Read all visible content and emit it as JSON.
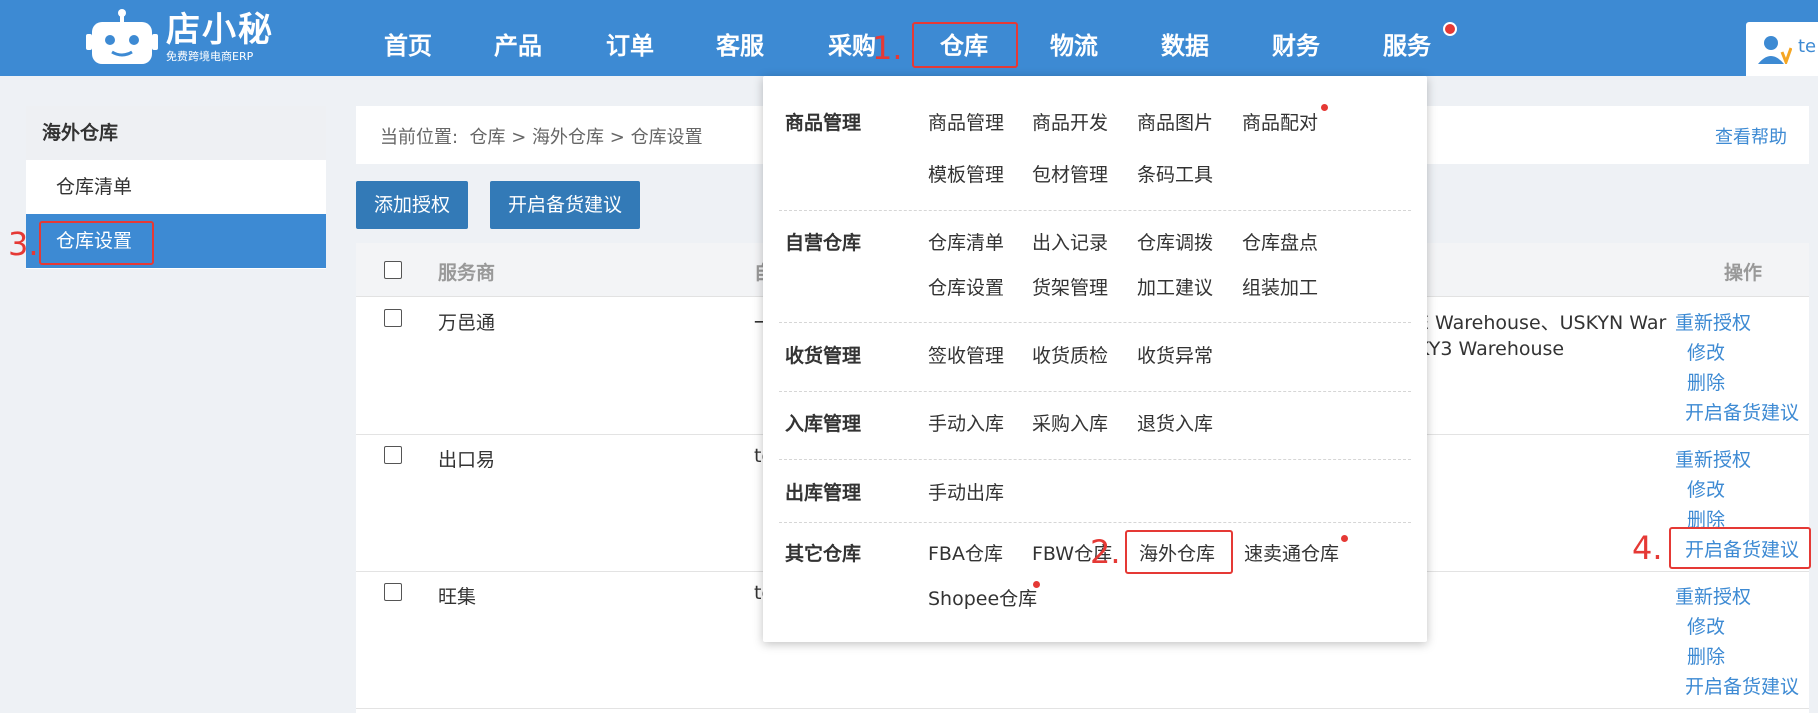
{
  "logo": {
    "title": "店小秘",
    "subtitle": "免费跨境电商ERP"
  },
  "nav": [
    {
      "label": "首页"
    },
    {
      "label": "产品"
    },
    {
      "label": "订单"
    },
    {
      "label": "客服"
    },
    {
      "label": "采购"
    },
    {
      "label": "仓库"
    },
    {
      "label": "物流"
    },
    {
      "label": "数据"
    },
    {
      "label": "财务"
    },
    {
      "label": "服务"
    }
  ],
  "user": {
    "label": "te"
  },
  "steps": {
    "s1": "1.",
    "s2": "2.",
    "s3": "3.",
    "s4": "4."
  },
  "sidebar": {
    "title": "海外仓库",
    "items": [
      {
        "label": "仓库清单"
      },
      {
        "label": "仓库设置"
      }
    ]
  },
  "breadcrumb": {
    "prefix": "当前位置:",
    "path": "仓库 > 海外仓库 > 仓库设置",
    "help": "查看帮助"
  },
  "toolbar": {
    "add_auth": "添加授权",
    "enable_suggest": "开启备货建议"
  },
  "table": {
    "headers": {
      "provider": "服务商",
      "second": "自",
      "actions": "操作"
    },
    "rows": [
      {
        "provider": "万邑通",
        "partial": "一",
        "warehouses_line1": "E Warehouse、USKYN War",
        "warehouses_line2": "KY3 Warehouse"
      },
      {
        "provider": "出口易",
        "partial": "te"
      },
      {
        "provider": "旺集",
        "partial": "te"
      }
    ],
    "actions": {
      "reauth": "重新授权",
      "edit": "修改",
      "delete": "删除",
      "suggest": "开启备货建议"
    }
  },
  "dropdown": {
    "sections": [
      {
        "label": "商品管理",
        "links": [
          "商品管理",
          "商品开发",
          "商品图片",
          "商品配对",
          "模板管理",
          "包材管理",
          "条码工具"
        ]
      },
      {
        "label": "自营仓库",
        "links": [
          "仓库清单",
          "出入记录",
          "仓库调拨",
          "仓库盘点",
          "仓库设置",
          "货架管理",
          "加工建议",
          "组装加工"
        ]
      },
      {
        "label": "收货管理",
        "links": [
          "签收管理",
          "收货质检",
          "收货异常"
        ]
      },
      {
        "label": "入库管理",
        "links": [
          "手动入库",
          "采购入库",
          "退货入库"
        ]
      },
      {
        "label": "出库管理",
        "links": [
          "手动出库"
        ]
      },
      {
        "label": "其它仓库",
        "links": [
          "FBA仓库",
          "FBW仓库",
          "海外仓库",
          "速卖通仓库",
          "Shopee仓库"
        ]
      }
    ]
  },
  "colors": {
    "primary": "#3d8ad3",
    "button": "#337ab7",
    "highlight": "#e53935"
  }
}
